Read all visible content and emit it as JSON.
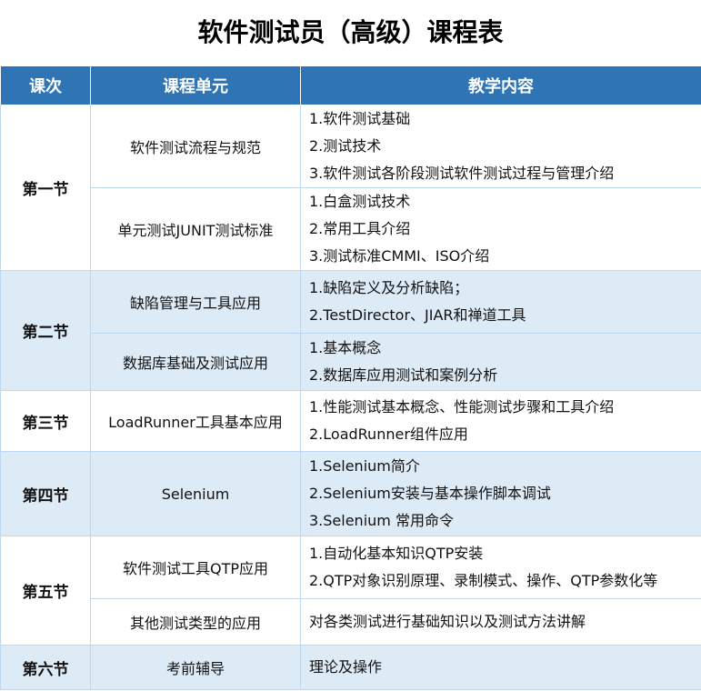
{
  "title": "软件测试员（高级）课程表",
  "headers": [
    "课次",
    "课程单元",
    "教学内容"
  ],
  "lessons": [
    {
      "label": "第一节",
      "units": [
        {
          "name": "软件测试流程与规范",
          "items": [
            "1.软件测试基础",
            "2.测试技术",
            "3.软件测试各阶段测试软件测试过程与管理介绍"
          ]
        },
        {
          "name": "单元测试JUNIT测试标准",
          "items": [
            "1.白盒测试技术",
            "2.常用工具介绍",
            "3.测试标准CMMI、ISO介绍"
          ]
        }
      ]
    },
    {
      "label": "第二节",
      "units": [
        {
          "name": "缺陷管理与工具应用",
          "items": [
            "1.缺陷定义及分析缺陷；",
            "2.TestDirector、JIAR和禅道工具"
          ]
        },
        {
          "name": "数据库基础及测试应用",
          "items": [
            "1.基本概念",
            "2.数据库应用测试和案例分析"
          ]
        }
      ]
    },
    {
      "label": "第三节",
      "units": [
        {
          "name": "LoadRunner工具基本应用",
          "items": [
            "1.性能测试基本概念、性能测试步骤和工具介绍",
            "2.LoadRunner组件应用"
          ]
        }
      ]
    },
    {
      "label": "第四节",
      "units": [
        {
          "name": "Selenium",
          "items": [
            "1.Selenium简介",
            "2.Selenium安装与基本操作脚本调试",
            "3.Selenium 常用命令"
          ]
        }
      ]
    },
    {
      "label": "第五节",
      "units": [
        {
          "name": "软件测试工具QTP应用",
          "items": [
            "1.自动化基本知识QTP安装",
            "2.QTP对象识别原理、录制模式、操作、QTP参数化等"
          ]
        },
        {
          "name": "其他测试类型的应用",
          "items": [
            "对各类测试进行基础知识以及测试方法讲解"
          ]
        }
      ]
    },
    {
      "label": "第六节",
      "units": [
        {
          "name": "考前辅导",
          "items": [
            "理论及操作"
          ]
        }
      ]
    }
  ]
}
